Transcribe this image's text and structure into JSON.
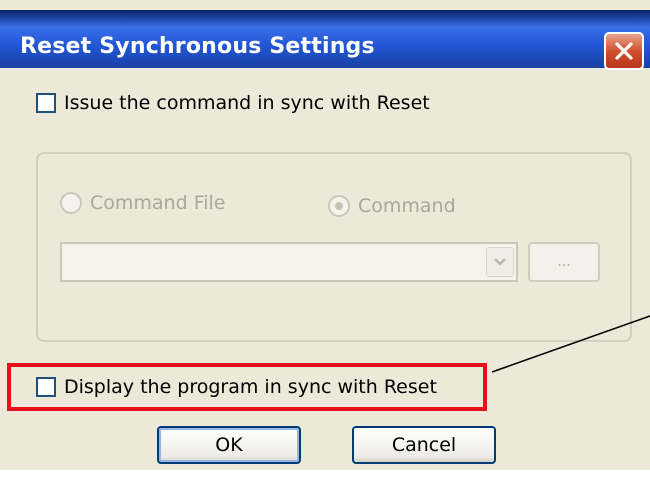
{
  "window": {
    "title": "Reset Synchronous Settings"
  },
  "options": {
    "issue_command_label": "Issue the command in sync with Reset",
    "issue_command_checked": false,
    "display_program_label": "Display the program in sync with Reset",
    "display_program_checked": false
  },
  "group": {
    "radio_command_file_label": "Command File",
    "radio_command_label": "Command",
    "selected_radio": "Command",
    "command_combo_value": "",
    "browse_label": "..."
  },
  "buttons": {
    "ok_label": "OK",
    "cancel_label": "Cancel"
  },
  "icons": {
    "close": "close-icon",
    "dropdown": "chevron-down-icon"
  },
  "colors": {
    "titlebar": "#2257d5",
    "close_button": "#d2502e",
    "dialog_background": "#ece9d8",
    "highlight_annotation": "#e8101a"
  }
}
